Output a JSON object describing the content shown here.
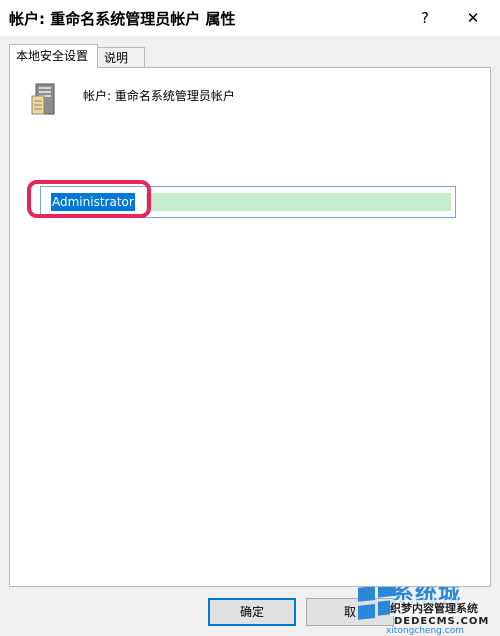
{
  "window": {
    "title": "帐户: 重命名系统管理员帐户 属性",
    "help_glyph": "?",
    "close_glyph": "✕"
  },
  "tabs": [
    {
      "label": "本地安全设置",
      "active": true
    },
    {
      "label": "说明",
      "active": false
    }
  ],
  "policy": {
    "icon": "server-icon",
    "label": "帐户: 重命名系统管理员帐户"
  },
  "account_name_input": {
    "value": "Administrator"
  },
  "buttons": {
    "ok": "确定",
    "cancel": "取"
  },
  "watermark": {
    "line1": "系统城",
    "line2": "织梦内容管理系统",
    "line3": "DEDECMS.COM",
    "line4": "xitongcheng.com"
  },
  "colors": {
    "highlight_ring": "#e8255b",
    "selection": "#0078d7",
    "input_fill": "#c6ecd0",
    "watermark_blue": "#2b88d8"
  }
}
